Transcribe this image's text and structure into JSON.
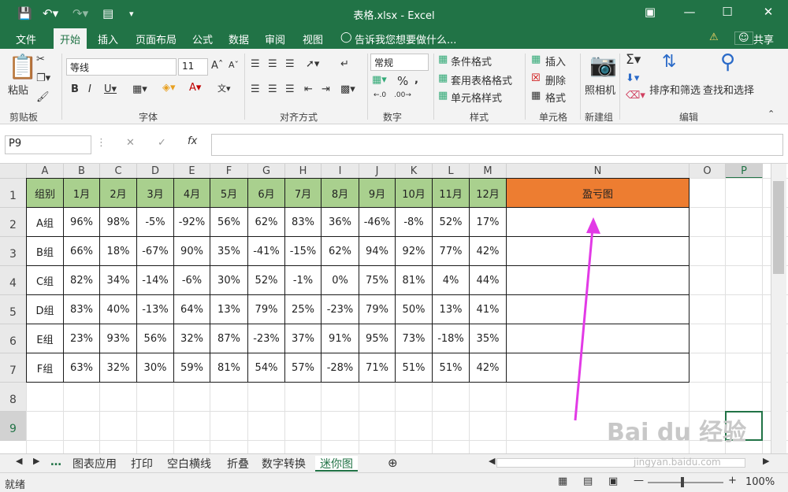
{
  "window": {
    "title": "表格.xlsx - Excel"
  },
  "ribbon_tabs": [
    "文件",
    "开始",
    "插入",
    "页面布局",
    "公式",
    "数据",
    "审阅",
    "视图"
  ],
  "tell_me": "告诉我您想要做什么...",
  "share": "共享",
  "ribbon": {
    "paste": "粘贴",
    "font_name": "等线",
    "font_size": "11",
    "number_format": "常规",
    "conditional_format": "条件格式",
    "table_format": "套用表格格式",
    "cell_style": "单元格样式",
    "insert": "插入",
    "delete": "删除",
    "format": "格式",
    "camera": "照相机",
    "sort_filter": "排序和筛选",
    "find_select": "查找和选择",
    "groups": [
      "剪贴板",
      "字体",
      "对齐方式",
      "数字",
      "样式",
      "单元格",
      "新建组",
      "编辑"
    ]
  },
  "name_box": "P9",
  "columns": [
    "A",
    "B",
    "C",
    "D",
    "E",
    "F",
    "G",
    "H",
    "I",
    "J",
    "K",
    "L",
    "M",
    "N",
    "O",
    "P"
  ],
  "rows": [
    "1",
    "2",
    "3",
    "4",
    "5",
    "6",
    "7",
    "8",
    "9"
  ],
  "table": {
    "header": [
      "组别",
      "1月",
      "2月",
      "3月",
      "4月",
      "5月",
      "6月",
      "7月",
      "8月",
      "9月",
      "10月",
      "11月",
      "12月",
      "盈亏图"
    ],
    "rows": [
      [
        "A组",
        "96%",
        "98%",
        "-5%",
        "-92%",
        "56%",
        "62%",
        "83%",
        "36%",
        "-46%",
        "-8%",
        "52%",
        "17%",
        ""
      ],
      [
        "B组",
        "66%",
        "18%",
        "-67%",
        "90%",
        "35%",
        "-41%",
        "-15%",
        "62%",
        "94%",
        "92%",
        "77%",
        "42%",
        ""
      ],
      [
        "C组",
        "82%",
        "34%",
        "-14%",
        "-6%",
        "30%",
        "52%",
        "-1%",
        "0%",
        "75%",
        "81%",
        "4%",
        "44%",
        ""
      ],
      [
        "D组",
        "83%",
        "40%",
        "-13%",
        "64%",
        "13%",
        "79%",
        "25%",
        "-23%",
        "79%",
        "50%",
        "13%",
        "41%",
        ""
      ],
      [
        "E组",
        "23%",
        "93%",
        "56%",
        "32%",
        "87%",
        "-23%",
        "37%",
        "91%",
        "95%",
        "73%",
        "-18%",
        "35%",
        ""
      ],
      [
        "F组",
        "63%",
        "32%",
        "30%",
        "59%",
        "81%",
        "54%",
        "57%",
        "-28%",
        "71%",
        "51%",
        "51%",
        "42%",
        ""
      ]
    ]
  },
  "sheet_tabs": [
    "图表应用",
    "打印",
    "空白横线",
    "折叠",
    "数字转换",
    "迷你图"
  ],
  "active_sheet": "迷你图",
  "status": {
    "ready": "就绪",
    "zoom": "100%"
  },
  "watermark": {
    "brand": "Bai du 经验",
    "url": "jingyan.baidu.com"
  },
  "colors": {
    "excel_green": "#217346",
    "header_fill": "#a9d08e",
    "pl_header_fill": "#ed7d31",
    "arrow": "#e23ae6"
  }
}
